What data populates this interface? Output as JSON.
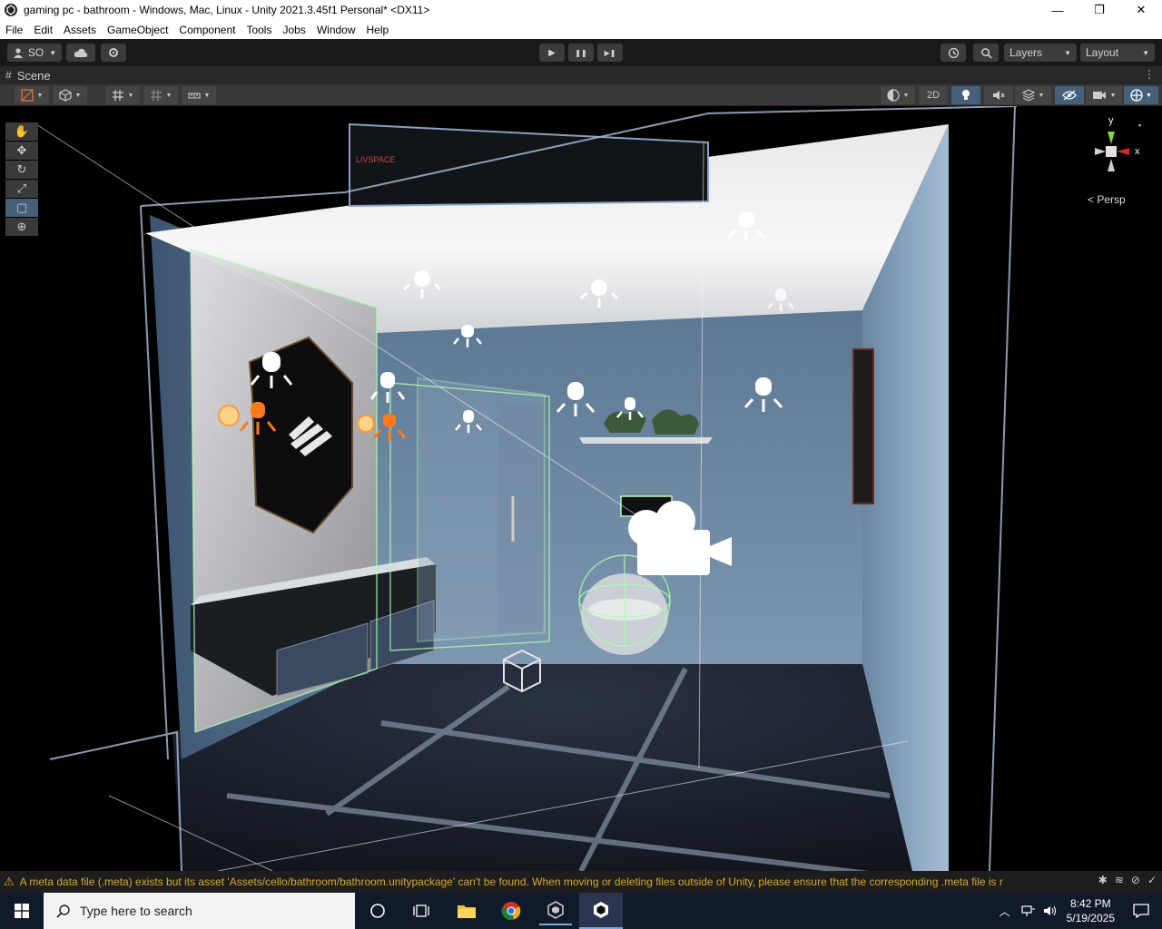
{
  "window": {
    "title": "gaming pc - bathroom - Windows, Mac, Linux - Unity 2021.3.45f1 Personal* <DX11>",
    "minimize": "—",
    "maximize": "❒",
    "close": "✕"
  },
  "menu": [
    "File",
    "Edit",
    "Assets",
    "GameObject",
    "Component",
    "Tools",
    "Jobs",
    "Window",
    "Help"
  ],
  "toolbar": {
    "account_label": "SO",
    "layers_label": "Layers",
    "layout_label": "Layout",
    "play_icon": "▶",
    "pause_icon": "❚❚",
    "step_icon": "▶❚"
  },
  "scene_tab": {
    "label": "Scene",
    "icon": "#"
  },
  "scene_toolbar": {
    "mode_2d": "2D"
  },
  "scene": {
    "sign_text": "LIVSPACE",
    "gizmo_y": "y",
    "gizmo_x": "x",
    "persp_label": "< Persp"
  },
  "tools": [
    "✋",
    "✥",
    "↻",
    "⤢",
    "▢",
    "⊕"
  ],
  "status": {
    "message": "A meta data file (.meta) exists but its asset 'Assets/cello/bathroom/bathroom.unitypackage' can't be found. When moving or deleting files outside of Unity, please ensure that the corresponding .meta file is r"
  },
  "taskbar": {
    "search_placeholder": "Type here to search",
    "time": "8:42 PM",
    "date": "5/19/2025"
  },
  "colors": {
    "accent": "#46607c",
    "warning": "#d9a92d",
    "wall": "#6f8aa6",
    "floor": "#1b2230",
    "wire": "#9dff9d",
    "light_orange": "#ff7a1a"
  }
}
